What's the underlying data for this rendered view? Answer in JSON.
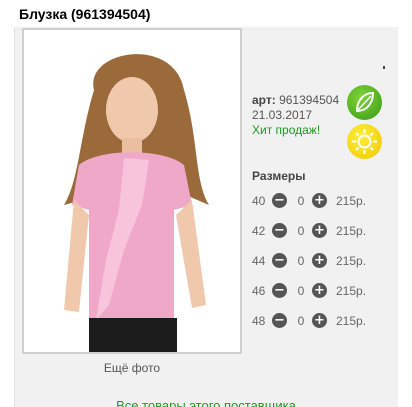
{
  "product": {
    "title": "Блузка (961394504)",
    "more_photos_label": "Ещё фото",
    "article_label": "арт:",
    "article_value": "961394504",
    "date": "21.03.2017",
    "hit_label": "Хит продаж!"
  },
  "badges": {
    "leaf_icon": "leaf-icon",
    "sun_icon": "sun-icon",
    "leaf_color": "#4caf1a",
    "sun_color": "#f5d000"
  },
  "sizes": {
    "title": "Размеры",
    "rows": [
      {
        "size": "40",
        "qty": "0",
        "price": "215р."
      },
      {
        "size": "42",
        "qty": "0",
        "price": "215р."
      },
      {
        "size": "44",
        "qty": "0",
        "price": "215р."
      },
      {
        "size": "46",
        "qty": "0",
        "price": "215р."
      },
      {
        "size": "48",
        "qty": "0",
        "price": "215р."
      }
    ],
    "minus_symbol": "−",
    "plus_symbol": "+"
  },
  "footer": {
    "supplier_link": "Все товары этого поставщика"
  }
}
